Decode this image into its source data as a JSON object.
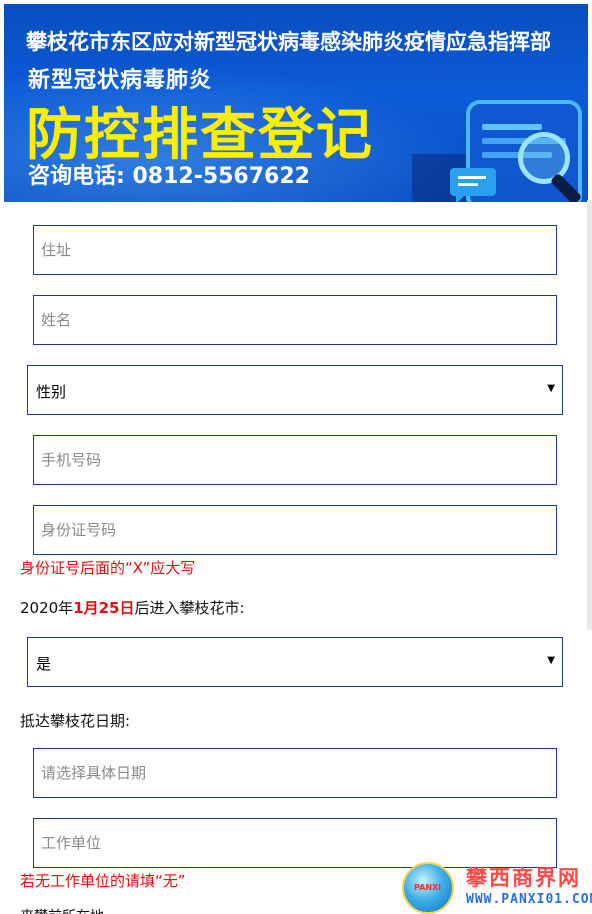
{
  "banner": {
    "org_title": "攀枝花市东区应对新型冠状病毒感染肺炎疫情应急指挥部",
    "subtitle": "新型冠状病毒肺炎",
    "main_title": "防控排查登记",
    "hotline": "咨询电话: 0812-5567622"
  },
  "form": {
    "address_placeholder": "住址",
    "name_placeholder": "姓名",
    "gender_select": {
      "selected": "性别"
    },
    "phone_placeholder": "手机号码",
    "id_placeholder": "身份证号码",
    "id_hint": "身份证号后面的“X”应大写",
    "entry_question": {
      "prefix": "2020年",
      "highlight": "1月25日",
      "suffix": "后进入攀枝花市:"
    },
    "entry_select": {
      "selected": "是"
    },
    "arrival_label": "抵达攀枝花日期:",
    "arrival_placeholder": "请选择具体日期",
    "work_placeholder": "工作单位",
    "work_hint": "若无工作单位的请填“无”",
    "cutoff_text": "来攀前所在地"
  },
  "watermark": {
    "name": "攀西商界网",
    "url": "WWW.PANXI01.COM",
    "globe_text": "PANXI"
  },
  "colors": {
    "banner_blue": "#0c5ad6",
    "title_yellow": "#ffee00",
    "hint_red": "#e01010",
    "field_border": "#1e3a8a"
  },
  "icons": {
    "select_arrow": "triangle-down-icon"
  }
}
